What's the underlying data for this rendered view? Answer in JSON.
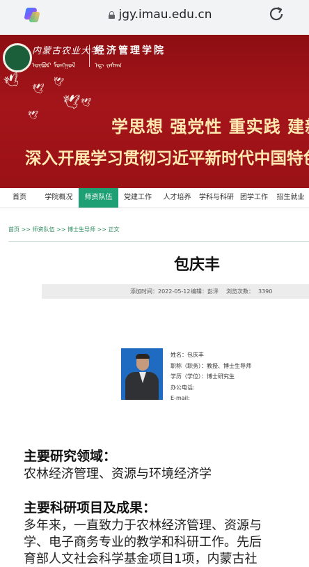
{
  "browser": {
    "url": "jgy.imau.edu.cn",
    "icons": {
      "app": "copilot-icon",
      "lock": "lock-icon",
      "reload": "reload-icon"
    }
  },
  "banner": {
    "university_name": "内蒙古农业大学",
    "college_name": "经济管理学院",
    "mongolian_1": "ᠥᠪᠦᠷ ᠮᠣᠩᠭᠣᠯ",
    "mongolian_2": "ᠡᠳ᠋ ᠵᠠᠰᠠᠭ",
    "slogan_line1": "学思想  强党性  重实践  建新功",
    "slogan_line2": "深入开展学习贯彻习近平新时代中国特色社会主义思想"
  },
  "nav": {
    "items": [
      {
        "label": "首页",
        "active": false
      },
      {
        "label": "学院概况",
        "active": false
      },
      {
        "label": "师资队伍",
        "active": true
      },
      {
        "label": "党建工作",
        "active": false
      },
      {
        "label": "人才培养",
        "active": false
      },
      {
        "label": "学科与科研",
        "active": false
      },
      {
        "label": "团学工作",
        "active": false
      },
      {
        "label": "招生就业",
        "active": false
      }
    ],
    "active_color": "#1fa074"
  },
  "breadcrumb": "首页 >> 师资队伍 >> 博士生导师 >> 正文",
  "article": {
    "title": "包庆丰",
    "meta": {
      "added": "添加时间：2022-05-12",
      "editor": "编辑：彭泽",
      "views_label": "浏览次数：",
      "views": "3390"
    }
  },
  "profile": {
    "name": "姓名：包庆丰",
    "title": "职称（职务）：教授、博士生导师",
    "degree": "学历（学位）：博士研究生",
    "phone": "办公电话:",
    "email": "E-mail:"
  },
  "sections": {
    "research_heading": "主要研究领域：",
    "research_text": "农林经济管理、资源与环境经济学",
    "projects_heading": "主要科研项目及成果：",
    "projects_line1": "多年来，一直致力于农林经济管理、资源与",
    "projects_line2": "学、电子商务专业的教学和科研工作。先后",
    "projects_line3": "育部人文社会科学基金项目1项，内蒙古社"
  }
}
